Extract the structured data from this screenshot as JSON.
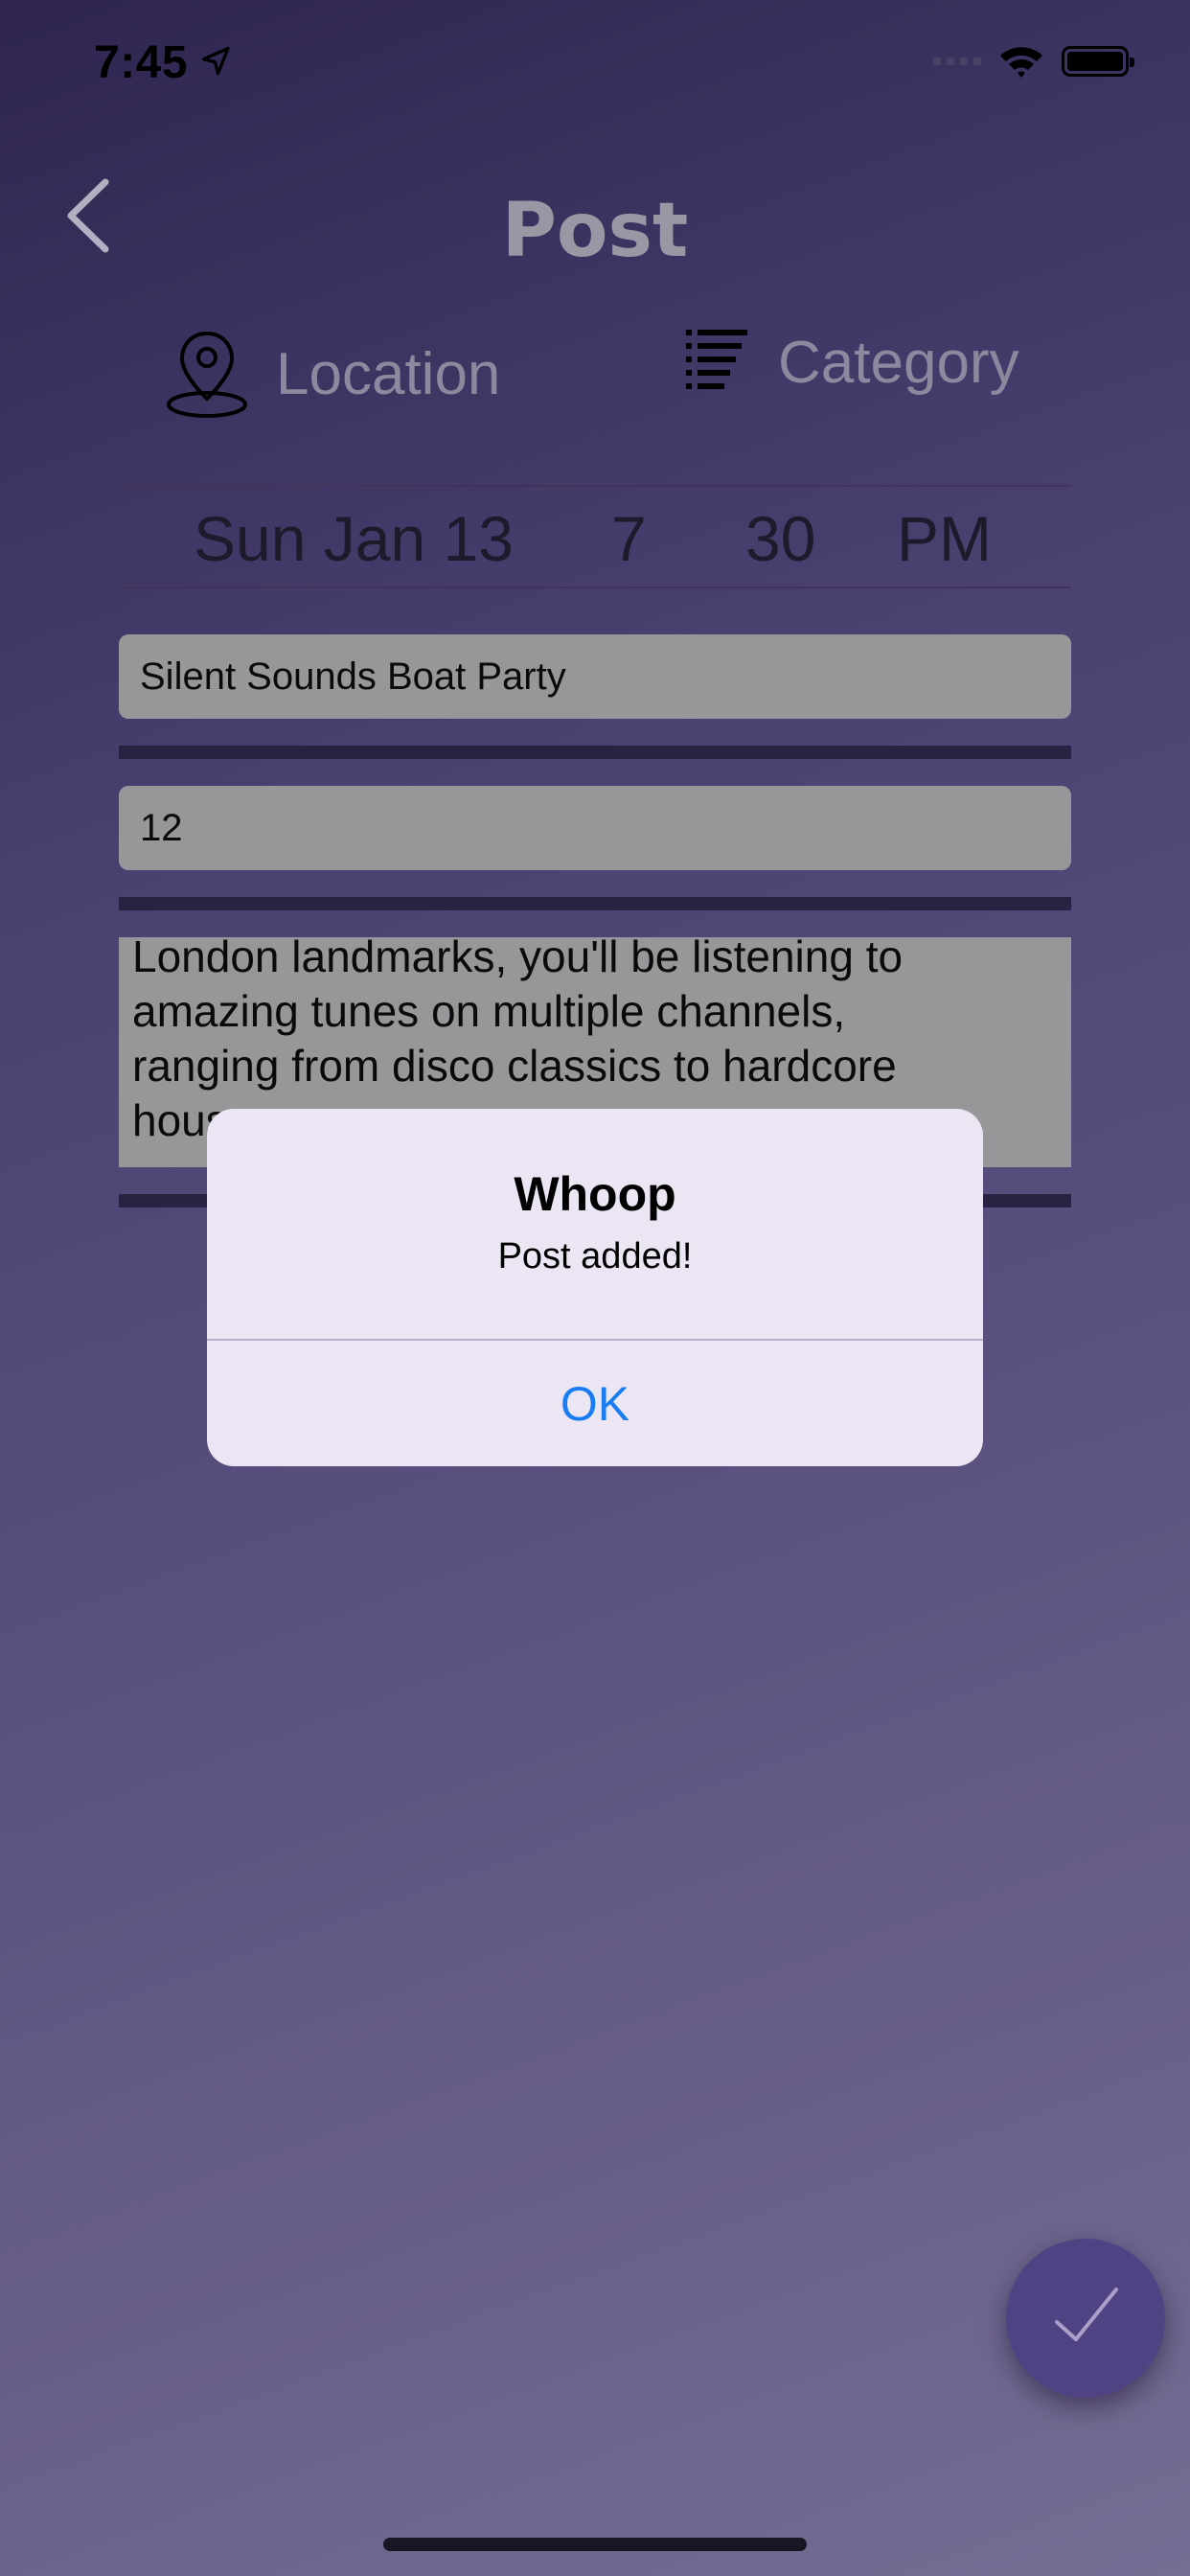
{
  "status_bar": {
    "time": "7:45"
  },
  "nav": {
    "title": "Post"
  },
  "selectors": {
    "location_label": "Location",
    "category_label": "Category"
  },
  "date_picker": {
    "date": "Sun Jan 13",
    "hour": "7",
    "minute": "30",
    "period": "PM"
  },
  "form": {
    "title_value": "Silent Sounds Boat Party",
    "number_value": "12",
    "description_lines": [
      "London landmarks, you'll be listening to",
      "amazing tunes on multiple channels,",
      "ranging from disco classics to hardcore",
      "hous"
    ]
  },
  "alert": {
    "title": "Whoop",
    "message": "Post added!",
    "ok_label": "OK"
  },
  "colors": {
    "accent_blue": "#1a7cf2",
    "fab": "#4f4384"
  },
  "icons": [
    "location-arrow-icon",
    "wifi-icon",
    "battery-icon",
    "back-chevron-icon",
    "map-pin-icon",
    "category-list-icon",
    "checkmark-icon"
  ]
}
